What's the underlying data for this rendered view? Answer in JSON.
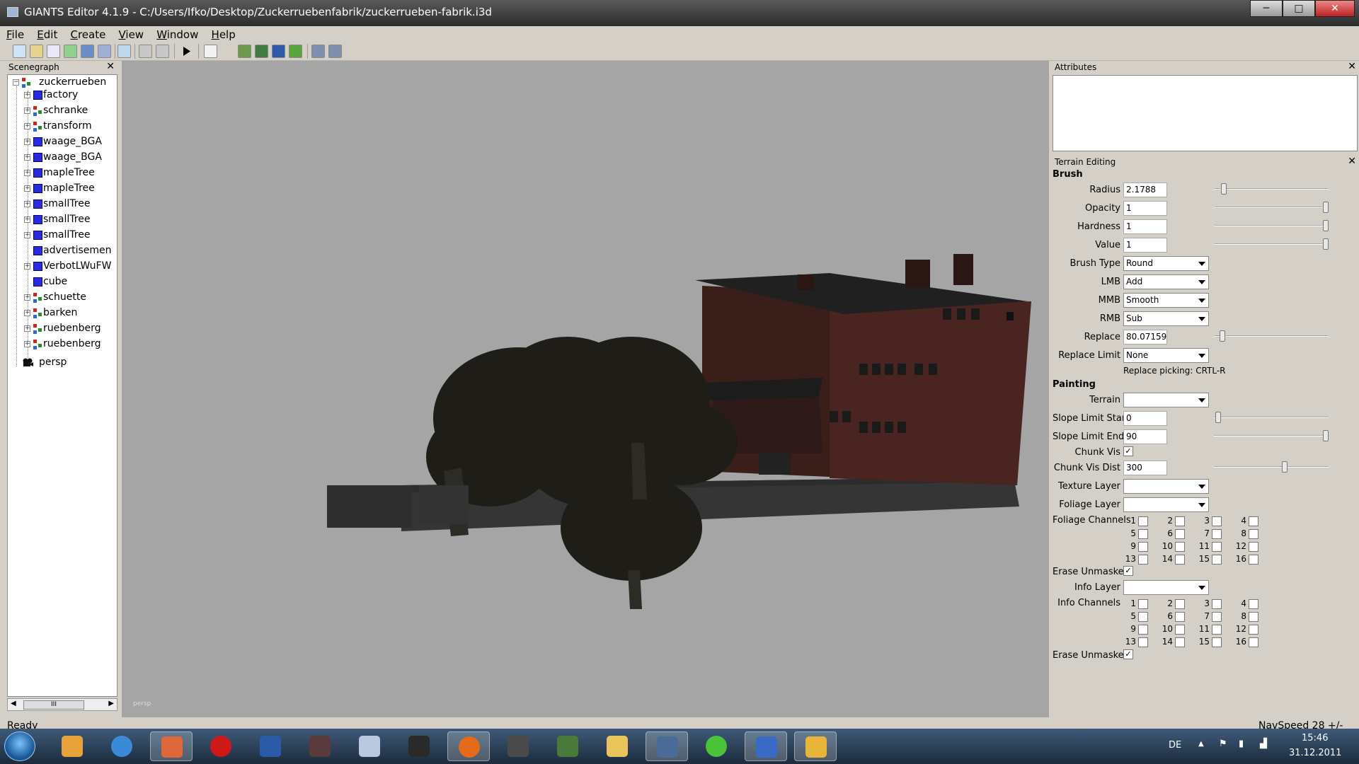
{
  "window": {
    "title": "GIANTS Editor 4.1.9 - C:/Users/Ifko/Desktop/Zuckerruebenfabrik/zuckerrueben-fabrik.i3d",
    "min": "─",
    "max": "□",
    "close": "✕"
  },
  "menu": [
    "File",
    "Edit",
    "Create",
    "View",
    "Window",
    "Help"
  ],
  "scenegraph": {
    "title": "Scenegraph",
    "close": "✕",
    "root": "zuckerrueben",
    "items": [
      {
        "label": "factory",
        "icon": "cube",
        "exp": true
      },
      {
        "label": "schranke",
        "icon": "transform",
        "exp": true
      },
      {
        "label": "transform",
        "icon": "transform",
        "exp": true
      },
      {
        "label": "waage_BGA",
        "icon": "cube",
        "exp": true
      },
      {
        "label": "waage_BGA",
        "icon": "cube",
        "exp": true
      },
      {
        "label": "mapleTree",
        "icon": "cube",
        "exp": true
      },
      {
        "label": "mapleTree",
        "icon": "cube",
        "exp": true
      },
      {
        "label": "smallTree",
        "icon": "cube",
        "exp": true
      },
      {
        "label": "smallTree",
        "icon": "cube",
        "exp": true
      },
      {
        "label": "smallTree",
        "icon": "cube",
        "exp": true
      },
      {
        "label": "advertisemen",
        "icon": "cube",
        "exp": false
      },
      {
        "label": "VerbotLWuFW",
        "icon": "cube",
        "exp": true
      },
      {
        "label": "cube",
        "icon": "cube",
        "exp": false
      },
      {
        "label": "schuette",
        "icon": "transform",
        "exp": true
      },
      {
        "label": "barken",
        "icon": "transform",
        "exp": true
      },
      {
        "label": "ruebenberg",
        "icon": "transform",
        "exp": true
      },
      {
        "label": "ruebenberg",
        "icon": "transform",
        "exp": true
      }
    ],
    "camera": "persp",
    "scroll_thumb": "III"
  },
  "viewport": {
    "label": "persp"
  },
  "status": {
    "left": "Ready",
    "right": "NavSpeed 28 +/-"
  },
  "attributes": {
    "title": "Attributes",
    "close": "✕"
  },
  "terrain": {
    "title": "Terrain Editing",
    "close": "✕",
    "brush_title": "Brush",
    "radius_label": "Radius",
    "radius": "2.1788",
    "opacity_label": "Opacity",
    "opacity": "1",
    "hardness_label": "Hardness",
    "hardness": "1",
    "value_label": "Value",
    "value": "1",
    "brushtype_label": "Brush Type",
    "brushtype": "Round",
    "lmb_label": "LMB",
    "lmb": "Add",
    "mmb_label": "MMB",
    "mmb": "Smooth",
    "rmb_label": "RMB",
    "rmb": "Sub",
    "replace_label": "Replace",
    "replace": "80.07159",
    "replacelimit_label": "Replace Limit",
    "replacelimit": "None",
    "replacepicking": "Replace picking: CRTL-R",
    "painting_title": "Painting",
    "terrain_label": "Terrain",
    "terrain_value": "",
    "slopestart_label": "Slope Limit Start",
    "slopestart": "0",
    "slopeend_label": "Slope Limit End",
    "slopeend": "90",
    "chunkvis_label": "Chunk Vis",
    "chunkvis": "✓",
    "chunkdist_label": "Chunk Vis Dist",
    "chunkdist": "300",
    "texlayer_label": "Texture Layer",
    "texlayer": "",
    "foliagelayer_label": "Foliage Layer",
    "foliagelayer": "",
    "foliagechannels_label": "Foliage Channels",
    "erase1_label": "Erase Unmasked",
    "erase1": "✓",
    "infolayer_label": "Info Layer",
    "infolayer": "",
    "infochannels_label": "Info Channels",
    "erase2_label": "Erase Unmasked",
    "erase2": "✓",
    "channels": [
      "1",
      "2",
      "3",
      "4",
      "5",
      "6",
      "7",
      "8",
      "9",
      "10",
      "11",
      "12",
      "13",
      "14",
      "15",
      "16"
    ]
  },
  "taskbar": {
    "lang": "DE",
    "time": "15:46",
    "date": "31.12.2011"
  }
}
